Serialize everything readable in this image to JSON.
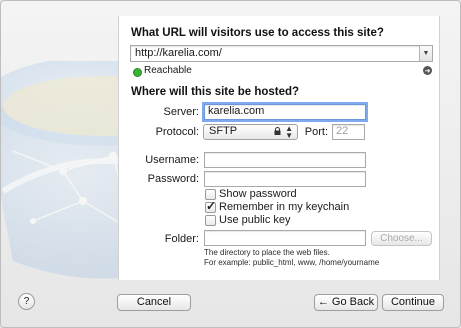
{
  "url_section": {
    "heading": "What URL will visitors use to access this site?",
    "url_value": "http://karelia.com/",
    "status": "Reachable"
  },
  "hosting_section": {
    "heading": "Where will this site be hosted?",
    "server_label": "Server:",
    "server_value": "karelia.com",
    "protocol_label": "Protocol:",
    "protocol_value": "SFTP",
    "port_label": "Port:",
    "port_placeholder": "22",
    "username_label": "Username:",
    "username_value": "",
    "password_label": "Password:",
    "password_value": "",
    "show_password": {
      "label": "Show password",
      "checked": false
    },
    "keychain": {
      "label": "Remember in my keychain",
      "checked": true
    },
    "public_key": {
      "label": "Use public key",
      "checked": false
    },
    "folder_label": "Folder:",
    "folder_value": "",
    "choose_label": "Choose...",
    "hint_line1": "The directory to place the web files.",
    "hint_line2": "For example: public_html, www, /home/yourname"
  },
  "footer": {
    "help_label": "?",
    "cancel_label": "Cancel",
    "back_label": "← Go Back",
    "continue_label": "Continue"
  },
  "icons": {
    "status_color": "#38b135"
  }
}
